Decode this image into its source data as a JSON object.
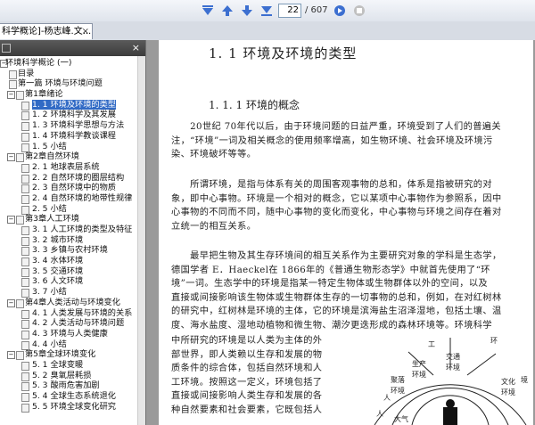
{
  "toolbar": {
    "current_page": "22",
    "total_pages": "/ 607",
    "icons": [
      "first-page-icon",
      "prev-page-icon",
      "next-page-icon",
      "last-page-icon",
      "go-icon",
      "stop-icon"
    ],
    "accent": "#3c6fd0"
  },
  "tab": {
    "title": "科学概论]-杨志峰.文...",
    "close": "×"
  },
  "sidebar": {
    "close": "×",
    "items": [
      {
        "label": "环境科学概论 (一)",
        "type": "root"
      },
      {
        "label": "目录",
        "type": "leaf"
      },
      {
        "label": "第一篇  环境与环境问题",
        "type": "leaf"
      },
      {
        "label": "第1章绪论",
        "type": "group"
      },
      {
        "label": "1. 1  环境及环境的类型",
        "type": "leaf",
        "selected": true
      },
      {
        "label": "1. 2  环境科学及其发展",
        "type": "leaf"
      },
      {
        "label": "1. 3  环境科学思想与方法",
        "type": "leaf"
      },
      {
        "label": "1. 4  环境科学教谈课程",
        "type": "leaf"
      },
      {
        "label": "1. 5  小结",
        "type": "leaf"
      },
      {
        "label": "第2章自然环境",
        "type": "group"
      },
      {
        "label": "2. 1  地球表层系统",
        "type": "leaf"
      },
      {
        "label": "2. 2  自然环境的圈层结构",
        "type": "leaf"
      },
      {
        "label": "2. 3  自然环境中的物质",
        "type": "leaf"
      },
      {
        "label": "2. 4  自然环境的地带性规律",
        "type": "leaf"
      },
      {
        "label": "2. 5  小结",
        "type": "leaf"
      },
      {
        "label": "第3章人工环境",
        "type": "group"
      },
      {
        "label": "3. 1  人工环境的类型及特征",
        "type": "leaf"
      },
      {
        "label": "3. 2  城市环境",
        "type": "leaf"
      },
      {
        "label": "3. 3  乡镇与农村环境",
        "type": "leaf"
      },
      {
        "label": "3. 4  水体环境",
        "type": "leaf"
      },
      {
        "label": "3. 5  交通环境",
        "type": "leaf"
      },
      {
        "label": "3. 6  人文环境",
        "type": "leaf"
      },
      {
        "label": "3. 7  小结",
        "type": "leaf"
      },
      {
        "label": "第4章人类活动与环境变化",
        "type": "group"
      },
      {
        "label": "4. 1  人类发展与环境的关系",
        "type": "leaf"
      },
      {
        "label": "4. 2  人类活动与环境问题",
        "type": "leaf"
      },
      {
        "label": "4. 3  环境与人类健康",
        "type": "leaf"
      },
      {
        "label": "4. 4  小结",
        "type": "leaf"
      },
      {
        "label": "第5章全球环境变化",
        "type": "group"
      },
      {
        "label": "5. 1  全球变暖",
        "type": "leaf"
      },
      {
        "label": "5. 2  臭氧层耗损",
        "type": "leaf"
      },
      {
        "label": "5. 3  酸雨危害加剧",
        "type": "leaf"
      },
      {
        "label": "5. 4  全球生态系统退化",
        "type": "leaf"
      },
      {
        "label": "5. 5  环境全球变化研究",
        "type": "leaf"
      }
    ]
  },
  "document": {
    "section_title": "1. 1  环境及环境的类型",
    "subsection_title": "1. 1. 1   环境的概念",
    "paragraphs": [
      [
        "　　20世纪 70年代以后，由于环境问题的日益严重，环境受到了人们的普遍关",
        "注，“环境”一词及相关概念的使用频率增高，如生物环境、社会环境及环境污",
        "染、环境破坏等等。"
      ],
      [
        "　　所谓环境，是指与体系有关的周围客观事物的总和，体系是指被研究的对",
        "象，即中心事物。环境是一个相对的概念，它以某项中心事物作为参照系，因中",
        "心事物的不同而不同，随中心事物的变化而变化，中心事物与环境之间存在着对",
        "立统一的相互关系。"
      ],
      [
        "　　最早把生物及其生存环境间的相互关系作为主要研究对象的学科是生态学，",
        "德国学者 E．Haeckel在 1866年的《普通生物形态学》中就首先使用了“环",
        "境”一词。生态学中的环境是指某一特定生物体或生物群体以外的空间，以及",
        "直接或间接影响该生物体或生物群体生存的一切事物的总和，例如，在对红树林",
        "的研究中，红树林是环境的主体，它的环境是滨海盐生沼泽湿地，包括土壤、温",
        "度、海水盐度、湿地动植物和微生物、潮汐更迭形成的森林环境等。环境科学"
      ],
      [
        "中所研究的环境是以人类为主体的外",
        "部世界，即人类赖以生存和发展的物",
        "质条件的综合体，包括自然环境和人",
        "工环境。按照这一定义，环境包括了",
        "直接或间接影响人类生存和发展的各",
        "种自然要素和社会要素，它既包括人"
      ]
    ],
    "figure_labels": [
      "工",
      "环",
      "交通",
      "环境",
      "生产",
      "环境",
      "人",
      "聚落",
      "环境",
      "文化",
      "环境",
      "境",
      "人",
      "大气"
    ]
  }
}
